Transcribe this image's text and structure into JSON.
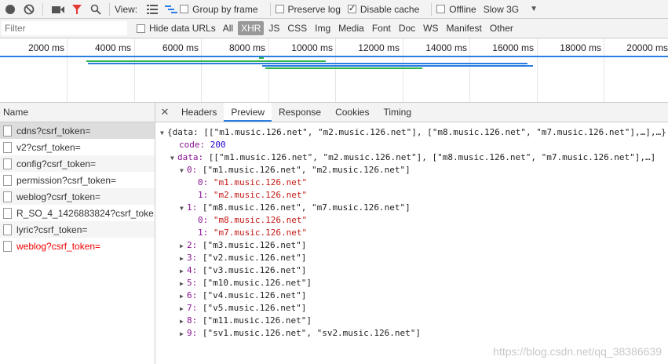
{
  "toolbar": {
    "view_label": "View:",
    "group_by_frame": "Group by frame",
    "preserve_log": "Preserve log",
    "disable_cache": "Disable cache",
    "offline": "Offline",
    "throttle": "Slow 3G",
    "group_by_frame_checked": false,
    "preserve_log_checked": false,
    "disable_cache_checked": true,
    "offline_checked": false
  },
  "filterbar": {
    "filter_placeholder": "Filter",
    "hide_data_urls": "Hide data URLs",
    "types": [
      "All",
      "XHR",
      "JS",
      "CSS",
      "Img",
      "Media",
      "Font",
      "Doc",
      "WS",
      "Manifest",
      "Other"
    ],
    "active_type": "XHR"
  },
  "timeline": {
    "ticks": [
      "2000 ms",
      "4000 ms",
      "6000 ms",
      "8000 ms",
      "10000 ms",
      "12000 ms",
      "14000 ms",
      "16000 ms",
      "18000 ms",
      "20000 ms"
    ]
  },
  "requests": {
    "header": "Name",
    "items": [
      {
        "name": "cdns?csrf_token="
      },
      {
        "name": "v2?csrf_token="
      },
      {
        "name": "config?csrf_token="
      },
      {
        "name": "permission?csrf_token="
      },
      {
        "name": "weblog?csrf_token="
      },
      {
        "name": "R_SO_4_1426883824?csrf_toke..."
      },
      {
        "name": "lyric?csrf_token="
      },
      {
        "name": "weblog?csrf_token="
      }
    ]
  },
  "detail_tabs": [
    "Headers",
    "Preview",
    "Response",
    "Cookies",
    "Timing"
  ],
  "active_tab": "Preview",
  "preview": {
    "root": "{data: [[\"m1.music.126.net\", \"m2.music.126.net\"], [\"m8.music.126.net\", \"m7.music.126.net\"],…],…}",
    "code_key": "code:",
    "code_value": "200",
    "data_key": "data:",
    "data_summary": "[[\"m1.music.126.net\", \"m2.music.126.net\"], [\"m8.music.126.net\", \"m7.music.126.net\"],…]",
    "entries": [
      {
        "index": "0:",
        "summary": "[\"m1.music.126.net\", \"m2.music.126.net\"]",
        "expanded": true,
        "children": [
          {
            "k": "0:",
            "v": "\"m1.music.126.net\""
          },
          {
            "k": "1:",
            "v": "\"m2.music.126.net\""
          }
        ]
      },
      {
        "index": "1:",
        "summary": "[\"m8.music.126.net\", \"m7.music.126.net\"]",
        "expanded": true,
        "children": [
          {
            "k": "0:",
            "v": "\"m8.music.126.net\""
          },
          {
            "k": "1:",
            "v": "\"m7.music.126.net\""
          }
        ]
      },
      {
        "index": "2:",
        "summary": "[\"m3.music.126.net\"]",
        "expanded": false
      },
      {
        "index": "3:",
        "summary": "[\"v2.music.126.net\"]",
        "expanded": false
      },
      {
        "index": "4:",
        "summary": "[\"v3.music.126.net\"]",
        "expanded": false
      },
      {
        "index": "5:",
        "summary": "[\"m10.music.126.net\"]",
        "expanded": false
      },
      {
        "index": "6:",
        "summary": "[\"v4.music.126.net\"]",
        "expanded": false
      },
      {
        "index": "7:",
        "summary": "[\"v5.music.126.net\"]",
        "expanded": false
      },
      {
        "index": "8:",
        "summary": "[\"m11.music.126.net\"]",
        "expanded": false
      },
      {
        "index": "9:",
        "summary": "[\"sv1.music.126.net\", \"sv2.music.126.net\"]",
        "expanded": false
      }
    ]
  },
  "watermark": "https://blog.csdn.net/qq_38386639",
  "colors": {
    "accent": "#2a7de1",
    "error": "#e00000",
    "record": "#555555",
    "filter_icon": "#e53935"
  }
}
